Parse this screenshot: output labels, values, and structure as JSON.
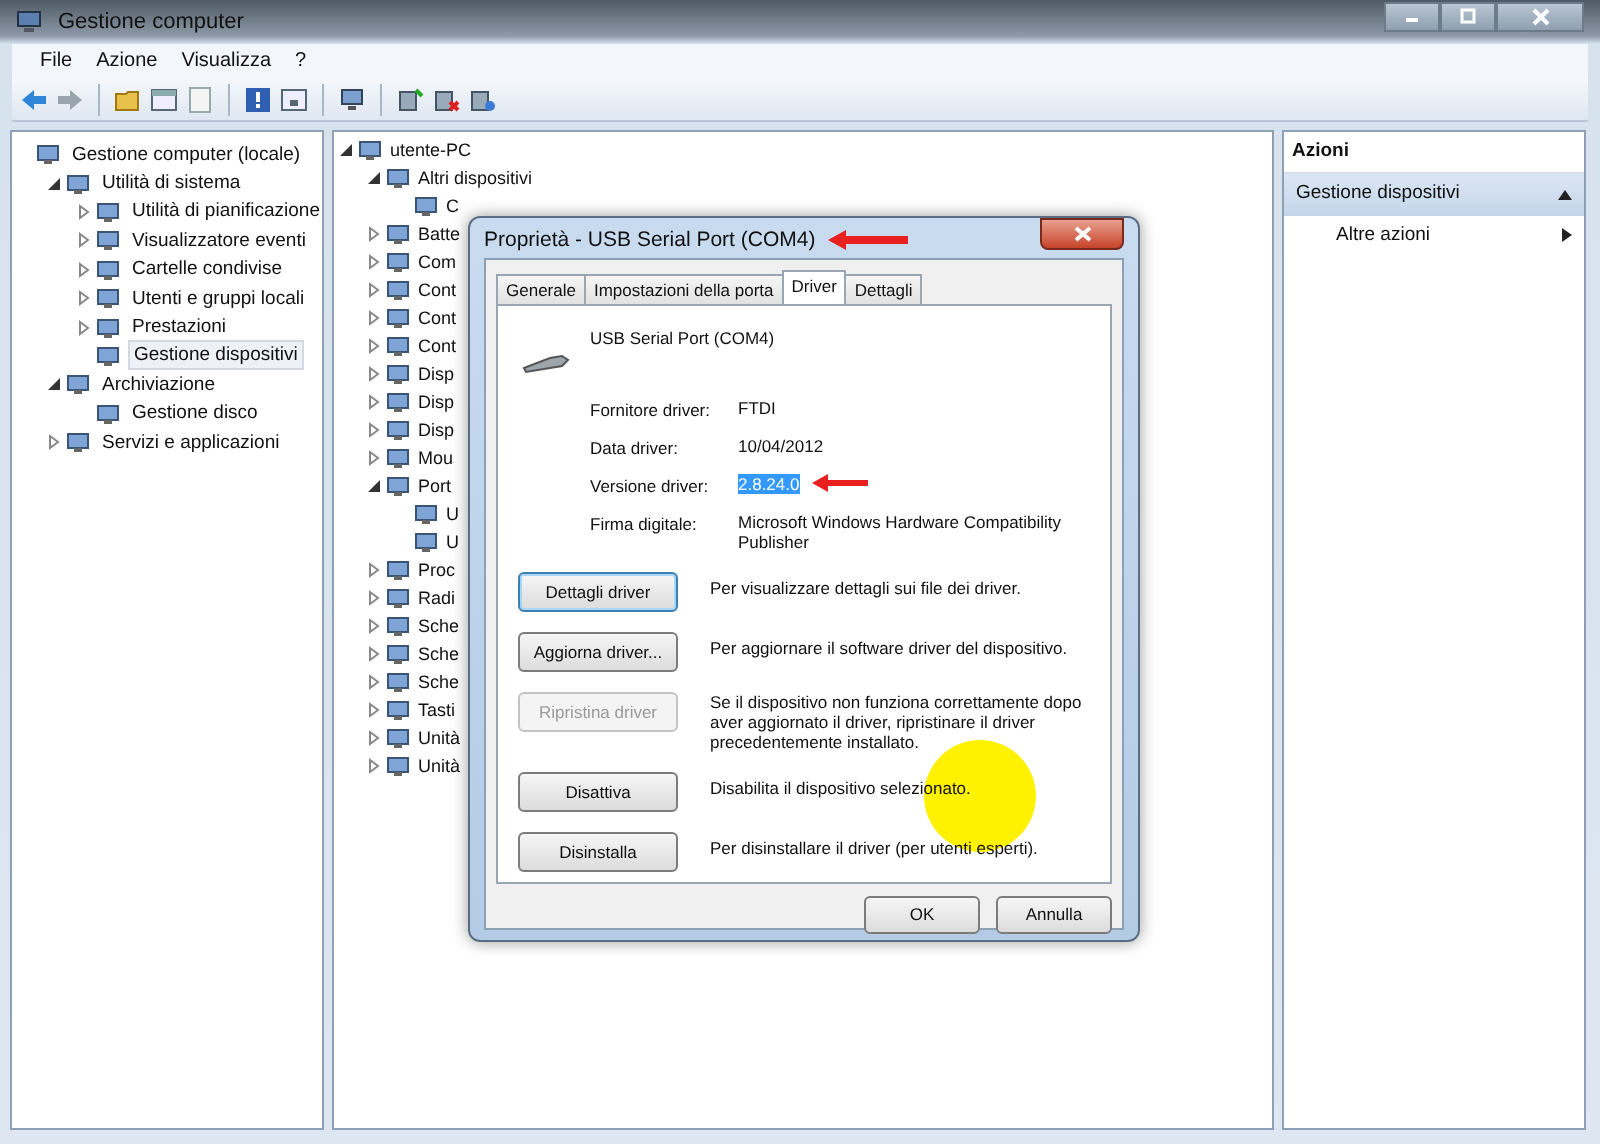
{
  "window": {
    "title": "Gestione computer"
  },
  "menu": [
    {
      "label": "File"
    },
    {
      "label": "Azione"
    },
    {
      "label": "Visualizza"
    },
    {
      "label": "?"
    }
  ],
  "left_tree": [
    {
      "label": "Gestione computer (locale)",
      "selected": false,
      "children": [
        {
          "label": "Utilità di sistema",
          "expanded": true,
          "selected": false,
          "children": [
            {
              "label": "Utilità di pianificazione",
              "expanded": false,
              "selected": false
            },
            {
              "label": "Visualizzatore eventi",
              "expanded": false,
              "selected": false
            },
            {
              "label": "Cartelle condivise",
              "expanded": false,
              "selected": false
            },
            {
              "label": "Utenti e gruppi locali",
              "expanded": false,
              "selected": false
            },
            {
              "label": "Prestazioni",
              "expanded": false,
              "selected": false
            },
            {
              "label": "Gestione dispositivi",
              "selected": true
            }
          ]
        },
        {
          "label": "Archiviazione",
          "expanded": true,
          "selected": false,
          "children": [
            {
              "label": "Gestione disco",
              "selected": false
            }
          ]
        },
        {
          "label": "Servizi e applicazioni",
          "expanded": false,
          "selected": false
        }
      ]
    }
  ],
  "device_tree": [
    {
      "label": "utente-PC",
      "expanded": true,
      "children": [
        {
          "label": "Altri dispositivi",
          "expanded": true,
          "children": [
            {
              "label": "C"
            }
          ]
        },
        {
          "label": "Batte",
          "expanded": false
        },
        {
          "label": "Com",
          "expanded": false
        },
        {
          "label": "Cont",
          "expanded": false
        },
        {
          "label": "Cont",
          "expanded": false
        },
        {
          "label": "Cont",
          "expanded": false
        },
        {
          "label": "Disp",
          "expanded": false
        },
        {
          "label": "Disp",
          "expanded": false
        },
        {
          "label": "Disp",
          "expanded": false
        },
        {
          "label": "Mou",
          "expanded": false
        },
        {
          "label": "Port",
          "expanded": true,
          "children": [
            {
              "label": "U"
            },
            {
              "label": "U"
            }
          ]
        },
        {
          "label": "Proc",
          "expanded": false
        },
        {
          "label": "Radi",
          "expanded": false
        },
        {
          "label": "Sche",
          "expanded": false
        },
        {
          "label": "Sche",
          "expanded": false
        },
        {
          "label": "Sche",
          "expanded": false
        },
        {
          "label": "Tasti",
          "expanded": false
        },
        {
          "label": "Unità",
          "expanded": false
        },
        {
          "label": "Unità",
          "expanded": false
        }
      ]
    }
  ],
  "actions": {
    "title": "Azioni",
    "section": {
      "label": "Gestione dispositivi",
      "expanded": true
    },
    "items": [
      {
        "label": "Altre azioni"
      }
    ]
  },
  "dialog": {
    "title": "Proprietà - USB Serial Port (COM4)",
    "tabs": [
      {
        "label": "Generale",
        "selected": false
      },
      {
        "label": "Impostazioni della porta",
        "selected": false
      },
      {
        "label": "Driver",
        "selected": true
      },
      {
        "label": "Dettagli",
        "selected": false
      }
    ],
    "device_name": "USB Serial Port (COM4)",
    "properties": [
      {
        "label": "Fornitore driver:",
        "value": "FTDI",
        "highlighted": false
      },
      {
        "label": "Data driver:",
        "value": "10/04/2012",
        "highlighted": false
      },
      {
        "label": "Versione driver:",
        "value": "2.8.24.0",
        "highlighted": true
      },
      {
        "label": "Firma digitale:",
        "value": "Microsoft Windows Hardware Compatibility Publisher",
        "highlighted": false
      }
    ],
    "actions": [
      {
        "button": "Dettagli driver",
        "description": "Per visualizzare dettagli sui file dei driver.",
        "disabled": false,
        "focused": true
      },
      {
        "button": "Aggiorna driver...",
        "description": "Per aggiornare il software driver del dispositivo.",
        "disabled": false,
        "focused": false
      },
      {
        "button": "Ripristina driver",
        "description": "Se il dispositivo non funziona correttamente dopo aver aggiornato il driver, ripristinare il driver precedentemente installato.",
        "disabled": true,
        "focused": false
      },
      {
        "button": "Disattiva",
        "description": "Disabilita il dispositivo selezionato.",
        "disabled": false,
        "focused": false
      },
      {
        "button": "Disinstalla",
        "description": "Per disinstallare il driver (per utenti esperti).",
        "disabled": false,
        "focused": false
      }
    ],
    "buttons": [
      {
        "label": "OK"
      },
      {
        "label": "Annulla"
      }
    ]
  }
}
